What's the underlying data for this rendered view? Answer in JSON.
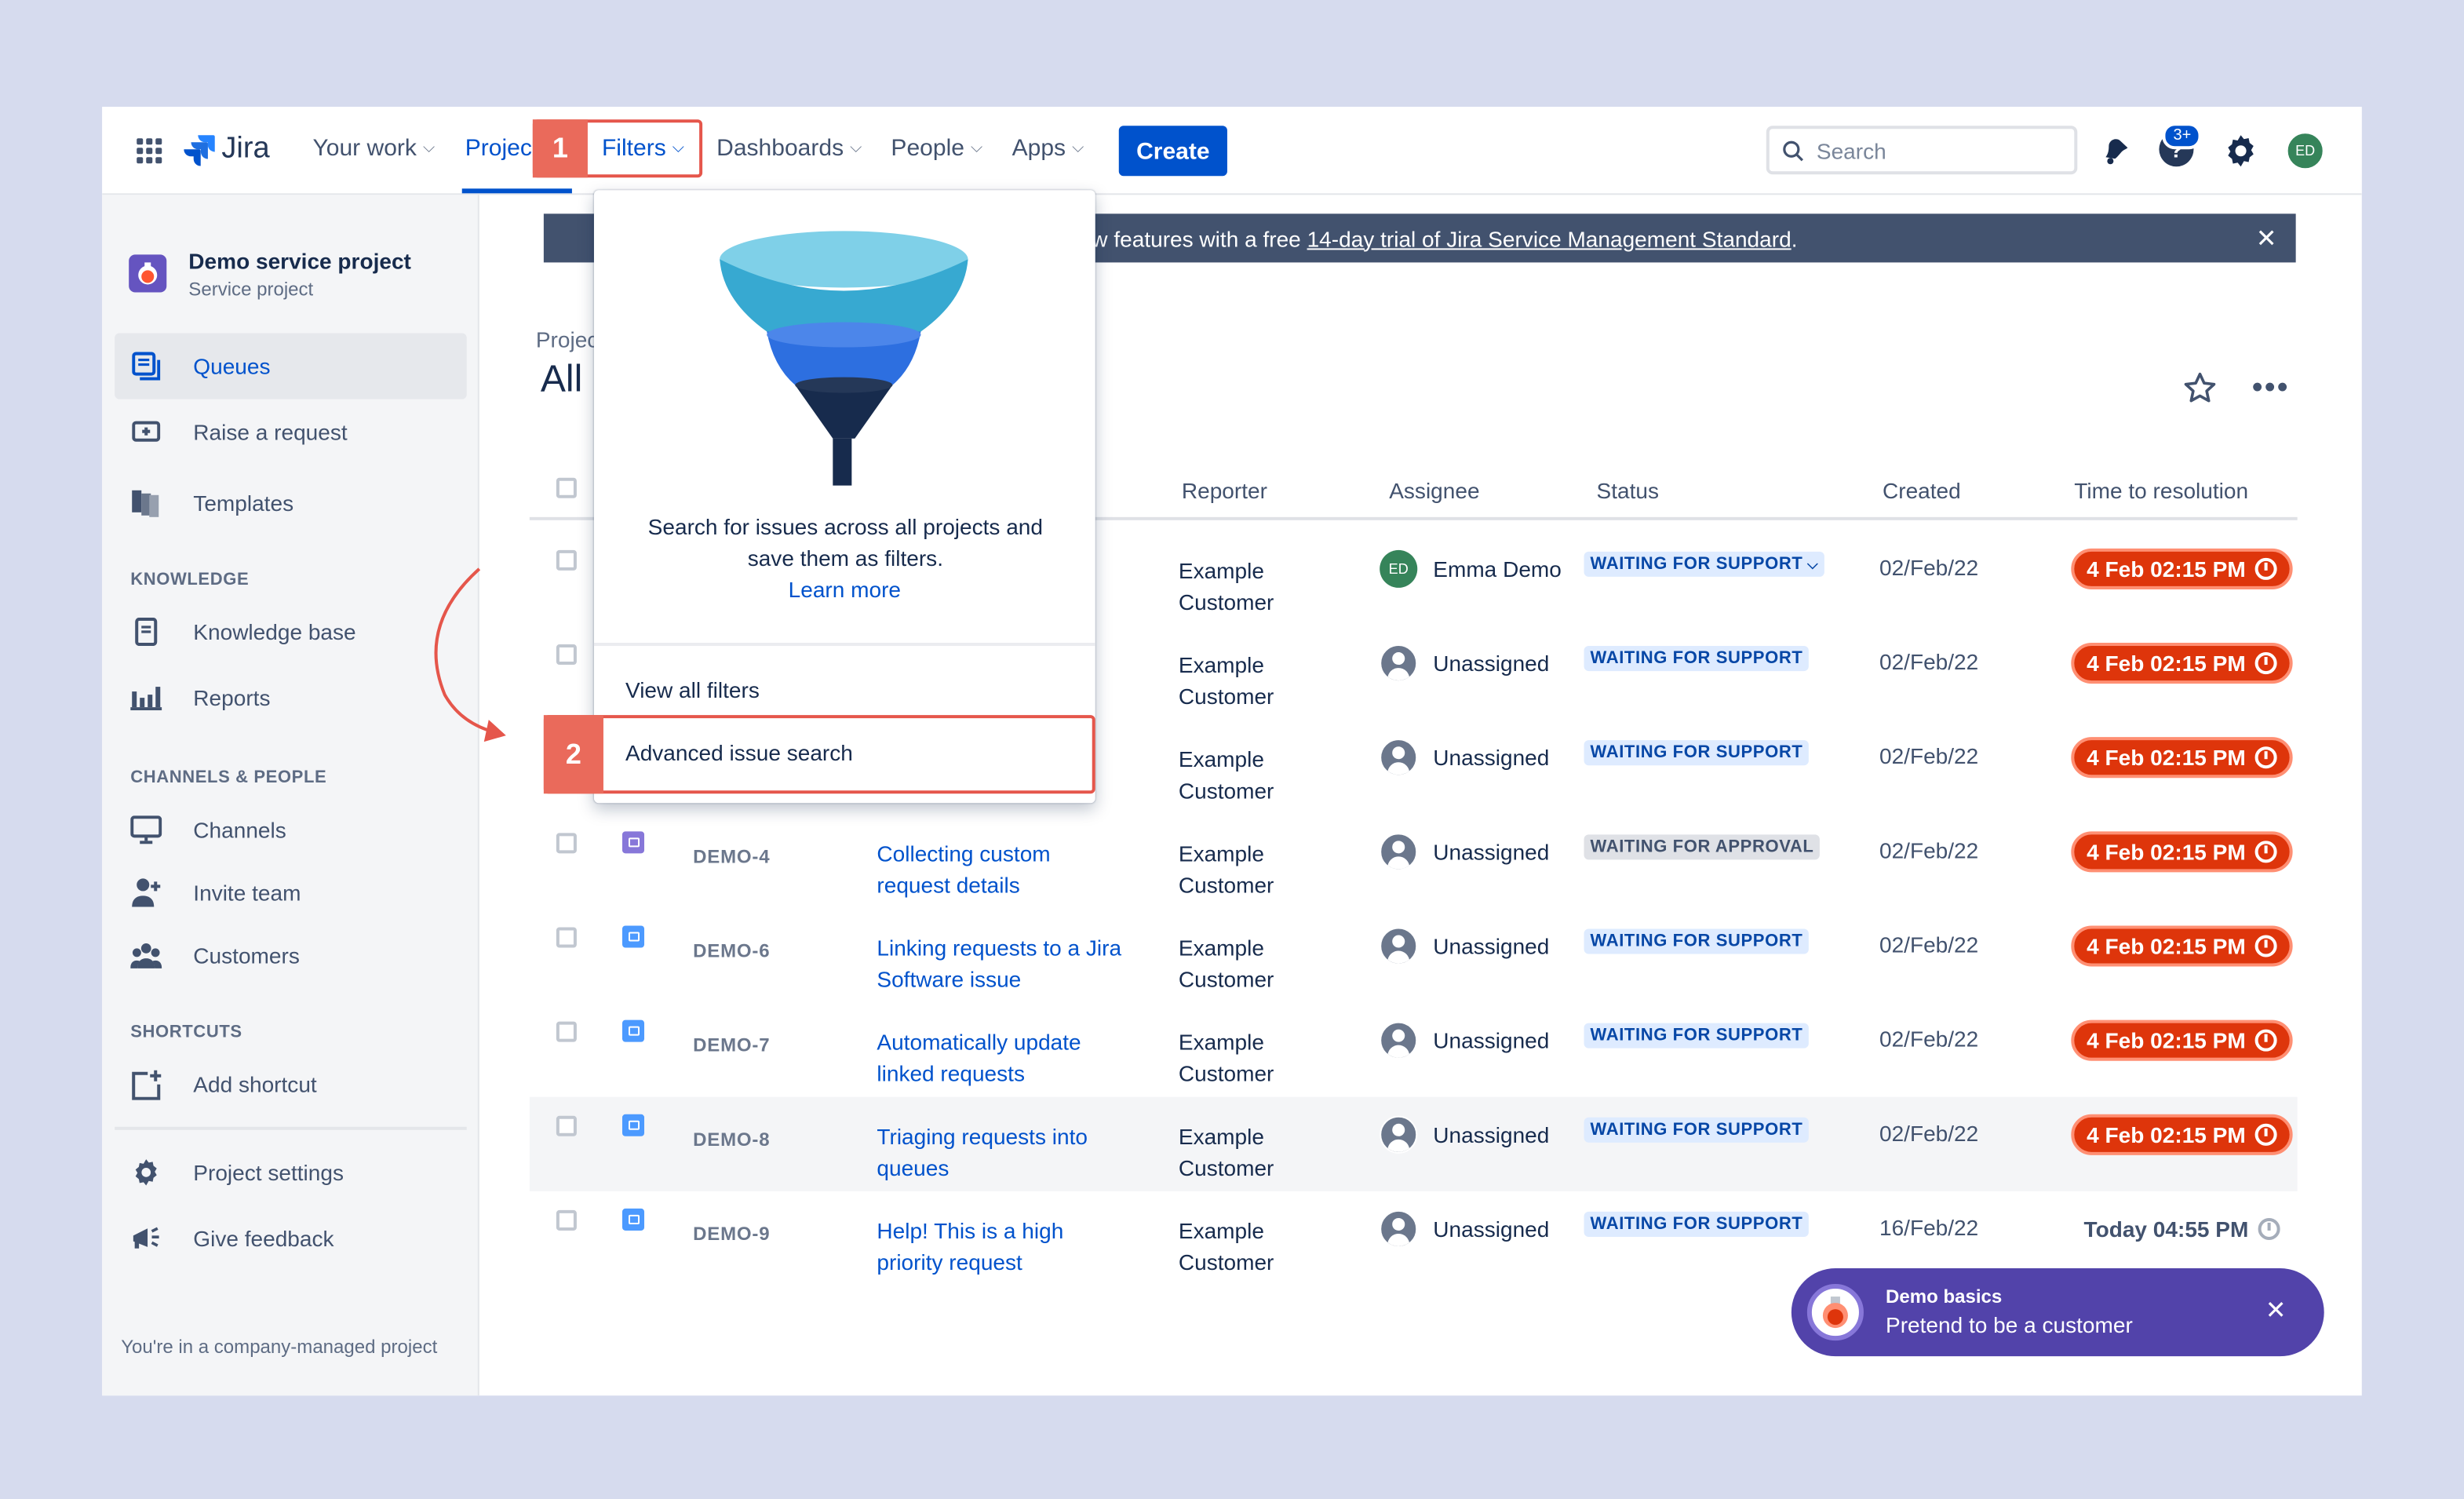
{
  "topnav": {
    "logo": "Jira",
    "items": [
      {
        "label": "Your work"
      },
      {
        "label": "Projec"
      },
      {
        "label": "Filters"
      },
      {
        "label": "Dashboards"
      },
      {
        "label": "People"
      },
      {
        "label": "Apps"
      }
    ],
    "create_label": "Create",
    "search_placeholder": "Search",
    "help_badge": "3+",
    "avatar_initials": "ED"
  },
  "callouts": {
    "step1": "1",
    "step2": "2"
  },
  "sidebar": {
    "project_name": "Demo service project",
    "project_type": "Service project",
    "items_main": [
      {
        "label": "Queues",
        "icon": "queue-icon"
      },
      {
        "label": "Raise a request",
        "icon": "raise-request-icon"
      },
      {
        "label": "Templates",
        "icon": "templates-icon"
      }
    ],
    "section_knowledge": "KNOWLEDGE",
    "items_knowledge": [
      {
        "label": "Knowledge base",
        "icon": "book-icon"
      },
      {
        "label": "Reports",
        "icon": "chart-icon"
      }
    ],
    "section_channels": "CHANNELS & PEOPLE",
    "items_channels": [
      {
        "label": "Channels",
        "icon": "monitor-icon"
      },
      {
        "label": "Invite team",
        "icon": "add-person-icon"
      },
      {
        "label": "Customers",
        "icon": "people-icon"
      }
    ],
    "section_shortcuts": "SHORTCUTS",
    "items_shortcuts": [
      {
        "label": "Add shortcut",
        "icon": "add-shortcut-icon"
      }
    ],
    "items_bottom": [
      {
        "label": "Project settings",
        "icon": "gear-icon"
      },
      {
        "label": "Give feedback",
        "icon": "megaphone-icon"
      }
    ],
    "footer": "You're in a company-managed project"
  },
  "banner": {
    "text_prefix": "ew features with a free ",
    "link": "14-day trial of Jira Service Management Standard",
    "text_suffix": "."
  },
  "page": {
    "breadcrumb": "Projec",
    "title": "All"
  },
  "dropdown": {
    "description": "Search for issues across all projects and save them as filters.",
    "learn_more": "Learn more",
    "view_all": "View all filters",
    "advanced": "Advanced issue search"
  },
  "table": {
    "headers": {
      "reporter": "Reporter",
      "assignee": "Assignee",
      "status": "Status",
      "created": "Created",
      "ttr": "Time to resolution"
    },
    "rows": [
      {
        "key": "",
        "summary": "",
        "reporter": "Example Customer",
        "assignee": "Emma Demo",
        "assignee_avatar": "ED",
        "status": "WAITING FOR SUPPORT",
        "status_dropdown": true,
        "created": "02/Feb/22",
        "ttr": "4 Feb 02:15 PM",
        "overdue": true
      },
      {
        "key": "",
        "summary": "",
        "reporter": "Example Customer",
        "assignee": "Unassigned",
        "status": "WAITING FOR SUPPORT",
        "created": "02/Feb/22",
        "ttr": "4 Feb 02:15 PM",
        "overdue": true
      },
      {
        "key": "",
        "summary": "",
        "reporter": "Example Customer",
        "assignee": "Unassigned",
        "status": "WAITING FOR SUPPORT",
        "created": "02/Feb/22",
        "ttr": "4 Feb 02:15 PM",
        "overdue": true
      },
      {
        "key": "DEMO-4",
        "summary": "Collecting custom request details",
        "reporter": "Example Customer",
        "assignee": "Unassigned",
        "status": "WAITING FOR APPROVAL",
        "created": "02/Feb/22",
        "ttr": "4 Feb 02:15 PM",
        "overdue": true
      },
      {
        "key": "DEMO-6",
        "summary": "Linking requests to a Jira Software issue",
        "reporter": "Example Customer",
        "assignee": "Unassigned",
        "status": "WAITING FOR SUPPORT",
        "created": "02/Feb/22",
        "ttr": "4 Feb 02:15 PM",
        "overdue": true
      },
      {
        "key": "DEMO-7",
        "summary": "Automatically update linked requests",
        "reporter": "Example Customer",
        "assignee": "Unassigned",
        "status": "WAITING FOR SUPPORT",
        "created": "02/Feb/22",
        "ttr": "4 Feb 02:15 PM",
        "overdue": true
      },
      {
        "key": "DEMO-8",
        "summary": "Triaging requests into queues",
        "reporter": "Example Customer",
        "assignee": "Unassigned",
        "status": "WAITING FOR SUPPORT",
        "created": "02/Feb/22",
        "ttr": "4 Feb 02:15 PM",
        "overdue": true
      },
      {
        "key": "DEMO-9",
        "summary": "Help! This is a high priority request",
        "reporter": "Example Customer",
        "assignee": "Unassigned",
        "status": "WAITING FOR SUPPORT",
        "created": "16/Feb/22",
        "ttr": "Today 04:55 PM",
        "overdue": false
      }
    ]
  },
  "toast": {
    "title": "Demo basics",
    "subtitle": "Pretend to be a customer"
  },
  "colors": {
    "accent": "#0052cc",
    "overdue": "#de350b",
    "callout": "#e5564b",
    "toast": "#5243aa"
  }
}
